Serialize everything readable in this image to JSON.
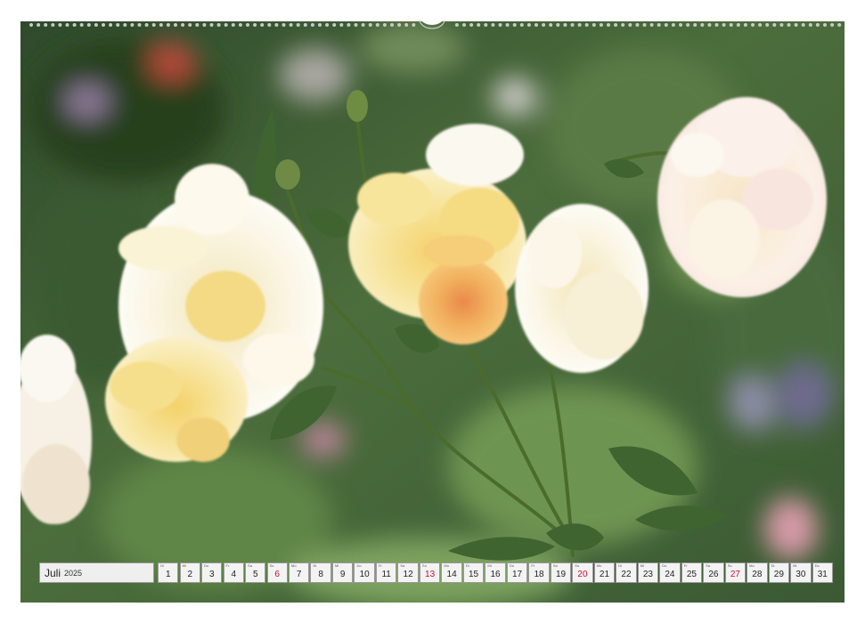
{
  "calendar": {
    "month": "Juli",
    "year": "2025",
    "days": [
      {
        "dow": "Di",
        "num": "1"
      },
      {
        "dow": "Mi",
        "num": "2"
      },
      {
        "dow": "Do",
        "num": "3"
      },
      {
        "dow": "Fr",
        "num": "4"
      },
      {
        "dow": "Sa",
        "num": "5"
      },
      {
        "dow": "So",
        "num": "6"
      },
      {
        "dow": "Mo",
        "num": "7"
      },
      {
        "dow": "Di",
        "num": "8"
      },
      {
        "dow": "Mi",
        "num": "9"
      },
      {
        "dow": "Do",
        "num": "10"
      },
      {
        "dow": "Fr",
        "num": "11"
      },
      {
        "dow": "Sa",
        "num": "12"
      },
      {
        "dow": "So",
        "num": "13"
      },
      {
        "dow": "Mo",
        "num": "14"
      },
      {
        "dow": "Di",
        "num": "15"
      },
      {
        "dow": "Mi",
        "num": "16"
      },
      {
        "dow": "Do",
        "num": "17"
      },
      {
        "dow": "Fr",
        "num": "18"
      },
      {
        "dow": "Sa",
        "num": "19"
      },
      {
        "dow": "So",
        "num": "20"
      },
      {
        "dow": "Mo",
        "num": "21"
      },
      {
        "dow": "Di",
        "num": "22"
      },
      {
        "dow": "Mi",
        "num": "23"
      },
      {
        "dow": "Do",
        "num": "24"
      },
      {
        "dow": "Fr",
        "num": "25"
      },
      {
        "dow": "Sa",
        "num": "26"
      },
      {
        "dow": "So",
        "num": "27"
      },
      {
        "dow": "Mo",
        "num": "28"
      },
      {
        "dow": "Di",
        "num": "29"
      },
      {
        "dow": "Mi",
        "num": "30"
      },
      {
        "dow": "Do",
        "num": "31"
      }
    ]
  },
  "colors": {
    "sunday": "#c8102e",
    "day_cell": "#f3f3f3",
    "month_cell": "#efefef",
    "cell_border": "#9a9a9a"
  }
}
